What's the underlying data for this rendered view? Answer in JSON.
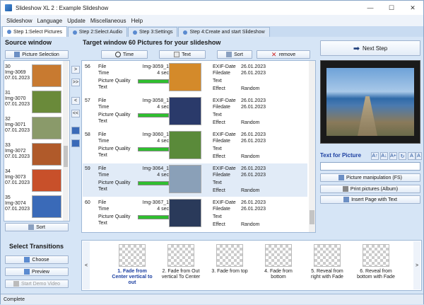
{
  "window": {
    "title": "Slideshow XL 2 : Example Slideshow",
    "controls": [
      "—",
      "☐",
      "✕"
    ]
  },
  "menu": [
    "Slideshow",
    "Language",
    "Update",
    "Miscellaneous",
    "Help"
  ],
  "tabs": [
    {
      "label": "Step 1:Select Pictures",
      "active": true
    },
    {
      "label": "Step 2:Select Audio",
      "active": false
    },
    {
      "label": "Step 3:Settings",
      "active": false
    },
    {
      "label": "Step 4:Create and start Slideshow",
      "active": false
    }
  ],
  "source": {
    "header": "Source window",
    "picture_selection": "Picture Selection",
    "sort": "Sort",
    "items": [
      {
        "num": "30",
        "name": "Img-3069",
        "date": "07.01.2023",
        "color": "#c87a30"
      },
      {
        "num": "31",
        "name": "Img-3070",
        "date": "07.01.2023",
        "color": "#6a8a3a"
      },
      {
        "num": "32",
        "name": "Img-3071",
        "date": "07.01.2023",
        "color": "#8a9a6a"
      },
      {
        "num": "33",
        "name": "Img-3072",
        "date": "07.01.2023",
        "color": "#b05a2a"
      },
      {
        "num": "34",
        "name": "Img-3073",
        "date": "07.01.2023",
        "color": "#c8502a"
      },
      {
        "num": "35",
        "name": "Img-3074",
        "date": "07.01.2023",
        "color": "#3a6ab8"
      }
    ]
  },
  "mid_buttons": [
    ">",
    ">>",
    "<",
    "<<"
  ],
  "target": {
    "header": "Target window 60 Pictures for your slideshow",
    "toolbar": {
      "time": "Time",
      "text": "Text",
      "sort": "Sort",
      "remove": "remove"
    },
    "field_labels": {
      "file": "File",
      "time": "Time",
      "quality": "Picture Quality",
      "text": "Text",
      "exif": "EXIF-Date",
      "filedate": "Filedate",
      "effect": "Effect"
    },
    "rows": [
      {
        "num": "56",
        "file": "Img-3059_1",
        "time": "4 sec",
        "quality": 1.0,
        "exif": "26.01.2023",
        "filedate": "26.01.2023",
        "effect": "Random",
        "color": "#d48a2a",
        "selected": false
      },
      {
        "num": "57",
        "file": "Img-3058_1",
        "time": "4 sec",
        "quality": 1.0,
        "exif": "26.01.2023",
        "filedate": "26.01.2023",
        "effect": "Random",
        "color": "#2a3a6a",
        "selected": false
      },
      {
        "num": "58",
        "file": "Img-3060_1",
        "time": "4 sec",
        "quality": 1.0,
        "exif": "26.01.2023",
        "filedate": "26.01.2023",
        "effect": "Random",
        "color": "#5a8a3a",
        "selected": false
      },
      {
        "num": "59",
        "file": "Img-3064_1",
        "time": "4 sec",
        "quality": 1.0,
        "exif": "26.01.2023",
        "filedate": "26.01.2023",
        "effect": "Random",
        "color": "#8aa0b8",
        "selected": true
      },
      {
        "num": "60",
        "file": "Img-3067_1",
        "time": "4 sec",
        "quality": 1.0,
        "exif": "26.01.2023",
        "filedate": "26.01.2023",
        "effect": "Random",
        "color": "#2a3a5a",
        "selected": false
      }
    ]
  },
  "right": {
    "next_step": "Next Step",
    "text_for_picture": "Text for Picture",
    "text_value": "",
    "manipulation": "Picture manipulation (FS)",
    "print": "Print pictures (Album)",
    "insert": "Insert Page with Text",
    "tools": [
      "A↑",
      "A↓",
      "A+",
      "↻",
      "A",
      "A"
    ]
  },
  "transitions": {
    "header": "Select Transitions",
    "choose": "Choose",
    "preview": "Preview",
    "demo": "Start Demo Video",
    "items": [
      {
        "label": "1. Fade from Center vertical to out",
        "selected": true
      },
      {
        "label": "2. Fade from Out vertical To Center",
        "selected": false
      },
      {
        "label": "3. Fade from top",
        "selected": false
      },
      {
        "label": "4. Fade from bottom",
        "selected": false
      },
      {
        "label": "5. Reveal from right with Fade",
        "selected": false
      },
      {
        "label": "6. Reveal from bottom with Fade",
        "selected": false
      }
    ]
  },
  "status": "Complete"
}
